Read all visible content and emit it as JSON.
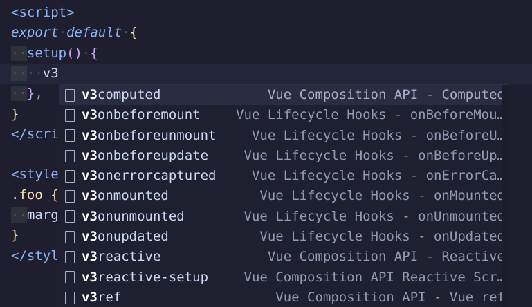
{
  "editor": {
    "lines": [
      {
        "parts": [
          {
            "t": "<script>",
            "c": "c-tag"
          }
        ]
      },
      {
        "parts": [
          {
            "t": "export",
            "c": "c-kw"
          },
          {
            "t": "·",
            "c": "ws"
          },
          {
            "t": "default",
            "c": "c-kw"
          },
          {
            "t": "·",
            "c": "ws"
          },
          {
            "t": "{",
            "c": "c-brace"
          }
        ]
      },
      {
        "parts": [
          {
            "t": "··",
            "c": "ws indent-guide"
          },
          {
            "t": "setup",
            "c": "c-fn"
          },
          {
            "t": "()",
            "c": "c-paren"
          },
          {
            "t": "·",
            "c": "ws"
          },
          {
            "t": "{",
            "c": "c-paren"
          }
        ]
      },
      {
        "parts": [
          {
            "t": "··",
            "c": "ws indent-guide"
          },
          {
            "t": "··",
            "c": "ws"
          },
          {
            "t": "v3",
            "c": "c-text"
          }
        ]
      },
      {
        "parts": [
          {
            "t": "··",
            "c": "ws indent-guide"
          },
          {
            "t": "}",
            "c": "c-paren"
          },
          {
            "t": ",",
            "c": "c-punc"
          }
        ]
      },
      {
        "parts": [
          {
            "t": "}",
            "c": "c-brace"
          }
        ]
      },
      {
        "parts": [
          {
            "t": "</scri",
            "c": "c-tag"
          }
        ]
      },
      {
        "parts": [
          {
            "t": "",
            "c": "c-text"
          }
        ]
      },
      {
        "parts": [
          {
            "t": "<style",
            "c": "c-tag"
          }
        ]
      },
      {
        "parts": [
          {
            "t": ".foo",
            "c": "c-sel"
          },
          {
            "t": " {",
            "c": "c-brace"
          }
        ]
      },
      {
        "parts": [
          {
            "t": "··",
            "c": "ws indent-guide"
          },
          {
            "t": "marg",
            "c": "c-text"
          }
        ]
      },
      {
        "parts": [
          {
            "t": "}",
            "c": "c-brace"
          }
        ]
      },
      {
        "parts": [
          {
            "t": "</styl",
            "c": "c-tag"
          }
        ]
      }
    ]
  },
  "suggest": {
    "match": "v3",
    "items": [
      {
        "rest": "computed",
        "detail": "Vue Composition API - Computed",
        "selected": true
      },
      {
        "rest": "onbeforemount",
        "detail": "Vue Lifecycle Hooks - onBeforeMou…"
      },
      {
        "rest": "onbeforeunmount",
        "detail": "Vue Lifecycle Hooks - onBeforeU…"
      },
      {
        "rest": "onbeforeupdate",
        "detail": "Vue Lifecycle Hooks - onBeforeUp…"
      },
      {
        "rest": "onerrorcaptured",
        "detail": "Vue Lifecycle Hooks - onErrorCa…"
      },
      {
        "rest": "onmounted",
        "detail": "Vue Lifecycle Hooks - onMounted"
      },
      {
        "rest": "onunmounted",
        "detail": "Vue Lifecycle Hooks - onUnmounted"
      },
      {
        "rest": "onupdated",
        "detail": "Vue Lifecycle Hooks - onUpdated"
      },
      {
        "rest": "reactive",
        "detail": "Vue Composition API - Reactive"
      },
      {
        "rest": "reactive-setup",
        "detail": "Vue Composition API Reactive Scr…"
      },
      {
        "rest": "ref",
        "detail": "Vue Composition API - Vue ref"
      }
    ],
    "icon": "snippet-icon"
  }
}
